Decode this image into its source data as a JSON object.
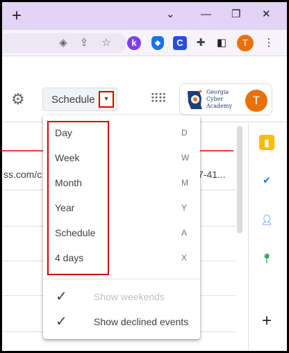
{
  "browser": {
    "new_tab_symbol": "+",
    "controls": {
      "minimize": "⌄",
      "min": "—",
      "restore": "❐",
      "close": "✕"
    },
    "profile_initial": "T",
    "extensions": {
      "k_label": "k",
      "c_label": "C"
    }
  },
  "calendar": {
    "view_button": {
      "label": "Schedule",
      "arrow": "▾"
    },
    "org_logo": {
      "line1": "Georgia",
      "line2": "Cyber",
      "line3": "Academy"
    },
    "account_initial": "T",
    "event_fragments": {
      "left": "ss.com/c",
      "right": "7-41..."
    }
  },
  "view_menu": {
    "items": [
      {
        "label": "Day",
        "shortcut": "D"
      },
      {
        "label": "Week",
        "shortcut": "W"
      },
      {
        "label": "Month",
        "shortcut": "M"
      },
      {
        "label": "Year",
        "shortcut": "Y"
      },
      {
        "label": "Schedule",
        "shortcut": "A"
      },
      {
        "label": "4 days",
        "shortcut": "X"
      }
    ],
    "toggles": [
      {
        "label": "Show weekends",
        "checked": true,
        "enabled": false
      },
      {
        "label": "Show declined events",
        "checked": true,
        "enabled": true
      }
    ],
    "check_symbol": "✓"
  },
  "side_panel": {
    "add_symbol": "+"
  },
  "colors": {
    "title_bar": "#e3d3f5",
    "highlight_red": "#d50000",
    "current_time_line": "#ea4335",
    "avatar": "#e8710a"
  }
}
